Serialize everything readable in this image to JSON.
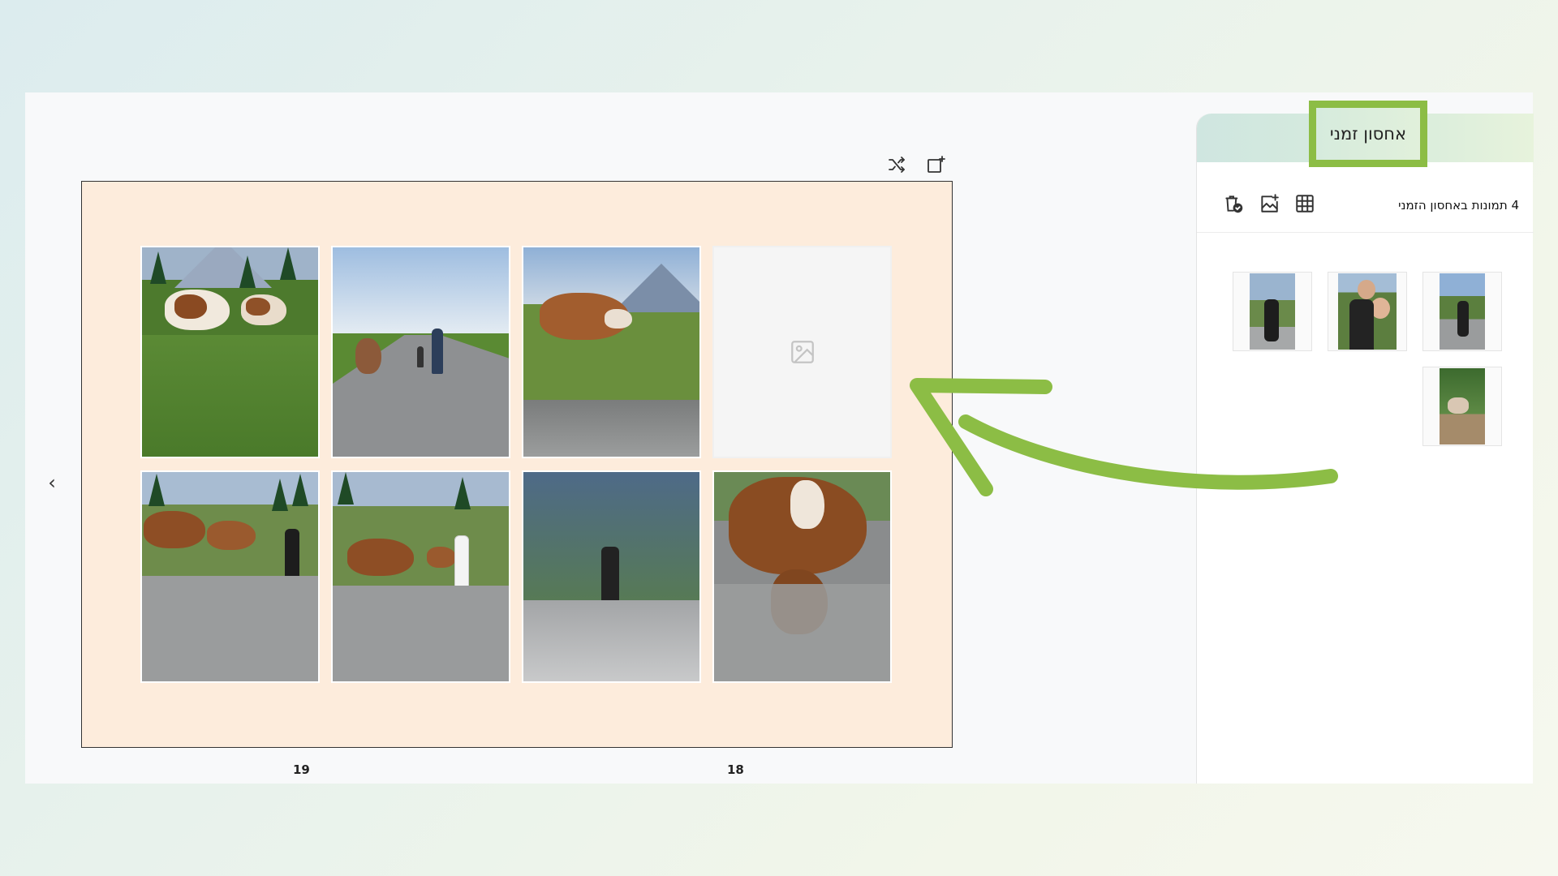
{
  "side_panel": {
    "tab_title": "אחסון זמני",
    "subtitle": "4 תמונות באחסון הזמני",
    "thumbnails": [
      {
        "alt": "photo-thumbnail"
      },
      {
        "alt": "photo-thumbnail"
      },
      {
        "alt": "photo-thumbnail"
      },
      {
        "alt": "photo-thumbnail"
      }
    ]
  },
  "editor": {
    "page_numbers": {
      "left": "19",
      "right": "18"
    },
    "prev_symbol": "‹"
  },
  "colors": {
    "accent_green": "#8cbd45",
    "page_background": "#fdecdc"
  },
  "icons": {
    "toolbar": [
      "shuffle-icon",
      "add-page-icon"
    ],
    "panel": [
      "grid-icon",
      "add-image-icon",
      "delete-used-icon"
    ],
    "placeholder": "image-placeholder-icon"
  }
}
